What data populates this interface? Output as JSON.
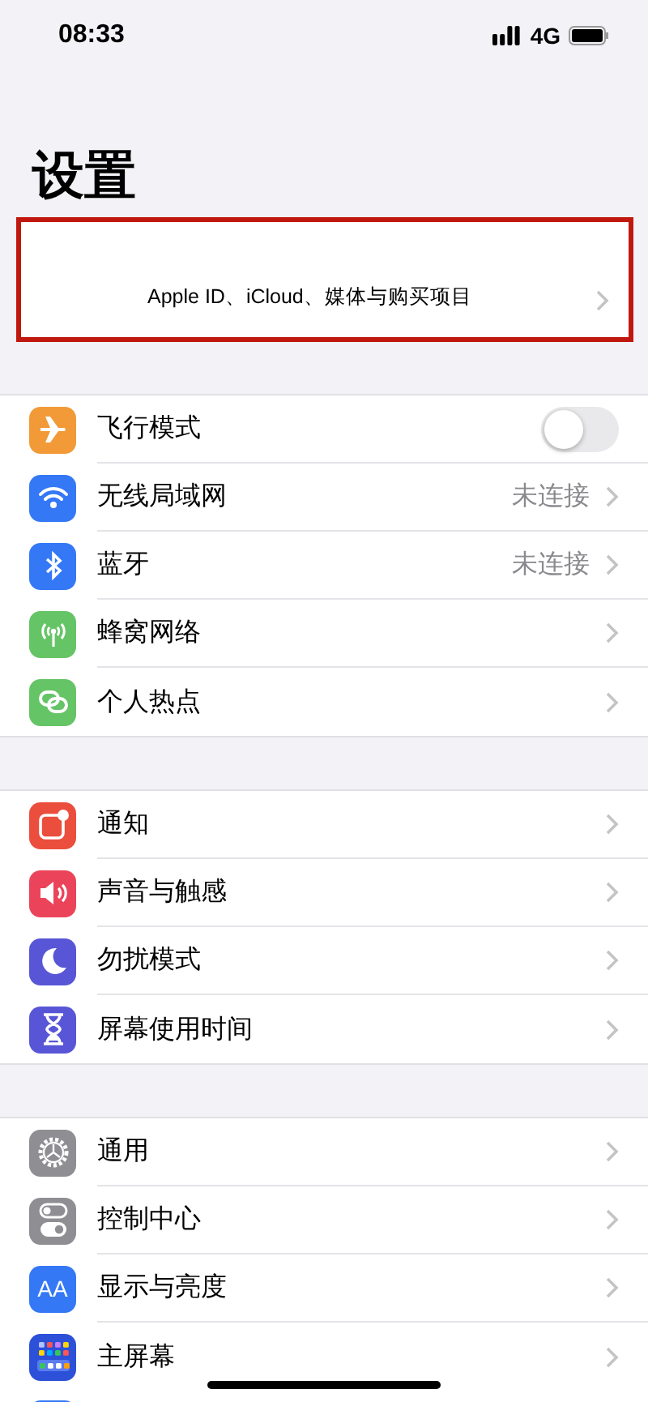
{
  "status_bar": {
    "time": "08:33",
    "network": "4G"
  },
  "title": "设置",
  "account": {
    "subtitle": "Apple ID、iCloud、媒体与购买项目",
    "highlighted": true
  },
  "groups": [
    {
      "items": [
        {
          "kind": "toggle",
          "label": "飞行模式",
          "on": false,
          "color": "#f19a37"
        },
        {
          "kind": "link",
          "label": "无线局域网",
          "value": "未连接",
          "color": "#3478f6"
        },
        {
          "kind": "link",
          "label": "蓝牙",
          "value": "未连接",
          "color": "#3478f6"
        },
        {
          "kind": "link",
          "label": "蜂窝网络",
          "color": "#65c466"
        },
        {
          "kind": "link",
          "label": "个人热点",
          "color": "#65c466"
        }
      ]
    },
    {
      "items": [
        {
          "kind": "link",
          "label": "通知",
          "color": "#eb4e3d"
        },
        {
          "kind": "link",
          "label": "声音与触感",
          "color": "#eb445a"
        },
        {
          "kind": "link",
          "label": "勿扰模式",
          "color": "#5856d6"
        },
        {
          "kind": "link",
          "label": "屏幕使用时间",
          "color": "#5856d6"
        }
      ]
    },
    {
      "items": [
        {
          "kind": "link",
          "label": "通用",
          "color": "#8e8e93"
        },
        {
          "kind": "link",
          "label": "控制中心",
          "color": "#8e8e93"
        },
        {
          "kind": "link",
          "label": "显示与亮度",
          "color": "#3478f6",
          "icon_text": "AA"
        },
        {
          "kind": "link",
          "label": "主屏幕",
          "color": "#2c50d8"
        },
        {
          "kind": "cut",
          "color": "#3478f6"
        }
      ]
    }
  ]
}
